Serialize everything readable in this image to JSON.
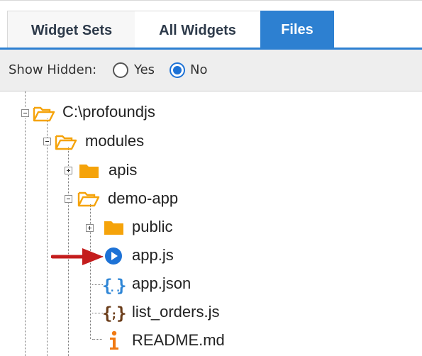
{
  "tabs": [
    {
      "label": "Widget Sets",
      "active": false
    },
    {
      "label": "All Widgets",
      "active": false
    },
    {
      "label": "Files",
      "active": true
    }
  ],
  "options": {
    "show_hidden_label": "Show Hidden:",
    "radio_yes": "Yes",
    "radio_no": "No",
    "selected": "No"
  },
  "tree": {
    "root": "C:\\profoundjs",
    "modules": "modules",
    "apis": "apis",
    "demo_app": "demo-app",
    "public": "public",
    "app_js": "app.js",
    "app_json": "app.json",
    "list_orders": "list_orders.js",
    "readme": "README.md"
  },
  "colors": {
    "accent": "#2d80d1",
    "folder": "#f5a30a",
    "arrow": "#c41d1d",
    "js_run": "#1d72d6"
  },
  "icons": {
    "open_folder": "folder-open-icon",
    "closed_folder": "folder-icon",
    "run_file": "play-circle-icon",
    "json_file": "json-braces-icon",
    "js_file": "js-braces-icon",
    "info_file": "info-icon",
    "pointer": "red-arrow-icon"
  }
}
